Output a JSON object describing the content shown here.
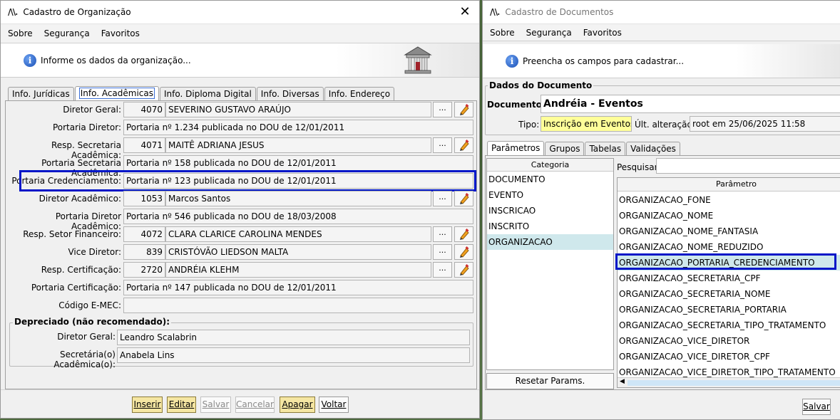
{
  "w1": {
    "title": "Cadastro de Organização",
    "menu": [
      "Sobre",
      "Segurança",
      "Favoritos"
    ],
    "banner_text": "Informe os dados da organização...",
    "tabs": [
      "Info. Jurídicas",
      "Info. Acadêmicas",
      "Info. Diploma Digital",
      "Info. Diversas",
      "Info. Endereço"
    ],
    "active_tab": "Info. Acadêmicas",
    "fields": [
      {
        "label": "Diretor Geral:",
        "code": "4070",
        "value": "SEVERINO GUSTAVO ARAÚJO",
        "lookup": true,
        "edit_enabled": true
      },
      {
        "label": "Portaria Diretor:",
        "value": "Portaria nº 1.234 publicada no DOU de 12/01/2011"
      },
      {
        "label": "Resp. Secretaria Acadêmica:",
        "code": "4071",
        "value": "MAITÊ ADRIANA JESUS",
        "lookup": true,
        "edit_enabled": true
      },
      {
        "label": "Portaria Secretaria Acadêmica:",
        "value": "Portaria nº 158 publicada no DOU de 12/01/2011"
      },
      {
        "label": "Portaria Credenciamento:",
        "value": "Portaria nº 123 publicada no DOU de 12/01/2011",
        "highlighted": true
      },
      {
        "label": "Diretor Acadêmico:",
        "code": "1053",
        "value": "Marcos Santos",
        "lookup": true,
        "edit_enabled": true
      },
      {
        "label": "Portaria Diretor Acadêmico:",
        "value": "Portaria nº 546 publicada no DOU de 18/03/2008"
      },
      {
        "label": "Resp. Setor Financeiro:",
        "code": "4072",
        "value": "CLARA CLARICE CAROLINA MENDES",
        "lookup": true,
        "edit_enabled": true
      },
      {
        "label": "Vice Diretor:",
        "code": "839",
        "value": "CRISTÓVÃO LIEDSON MALTA",
        "lookup": true,
        "edit_enabled": true
      },
      {
        "label": "Resp. Certificação:",
        "code": "2720",
        "value": "ANDRÉIA KLEHM",
        "lookup": true,
        "edit_enabled": true
      },
      {
        "label": "Portaria Certificação:",
        "value": "Portaria nº 147 publicada no DOU de 12/01/2011"
      },
      {
        "label": "Código E-MEC:",
        "value": ""
      }
    ],
    "lookup_label": "...",
    "deprecated": {
      "title": "Depreciado (não recomendado):",
      "fields": [
        {
          "label": "Diretor Geral:",
          "value": "Leandro Scalabrin"
        },
        {
          "label": "Secretária(o) Acadêmica(o):",
          "value": "Anabela Lins"
        }
      ]
    },
    "buttons": [
      {
        "label": "Inserir",
        "state": "primary"
      },
      {
        "label": "Editar",
        "state": "primary"
      },
      {
        "label": "Salvar",
        "state": "disabled"
      },
      {
        "label": "Cancelar",
        "state": "disabled"
      },
      {
        "label": "Apagar",
        "state": "primary"
      },
      {
        "label": "Voltar",
        "state": "normal"
      }
    ]
  },
  "w2": {
    "title": "Cadastro de Documentos",
    "menu": [
      "Sobre",
      "Segurança",
      "Favoritos"
    ],
    "banner_text": "Preencha os campos para cadastrar...",
    "section_title": "Dados do Documento",
    "documento_label": "Documento:",
    "documento_value": "Andréia - Eventos",
    "tipo_label": "Tipo:",
    "tipo_value": "Inscrição em Eventos",
    "ult_label": "Últ. alteração:",
    "ult_value": "root em 25/06/2025 11:58",
    "tabs": [
      "Parâmetros",
      "Grupos",
      "Tabelas",
      "Validações"
    ],
    "active_tab": "Parâmetros",
    "categoria_header": "Categoria",
    "categorias": [
      "DOCUMENTO",
      "EVENTO",
      "INSCRICAO",
      "INSCRITO",
      "ORGANIZACAO"
    ],
    "selected_categoria": "ORGANIZACAO",
    "pesquisar_label": "Pesquisar:",
    "parametro_header": "Parâmetro",
    "parametros": [
      "ORGANIZACAO_FONE",
      "ORGANIZACAO_NOME",
      "ORGANIZACAO_NOME_FANTASIA",
      "ORGANIZACAO_NOME_REDUZIDO",
      "ORGANIZACAO_PORTARIA_CREDENCIAMENTO",
      "ORGANIZACAO_SECRETARIA_CPF",
      "ORGANIZACAO_SECRETARIA_NOME",
      "ORGANIZACAO_SECRETARIA_PORTARIA",
      "ORGANIZACAO_SECRETARIA_TIPO_TRATAMENTO",
      "ORGANIZACAO_VICE_DIRETOR",
      "ORGANIZACAO_VICE_DIRETOR_CPF",
      "ORGANIZACAO_VICE_DIRETOR_TIPO_TRATAMENTO"
    ],
    "selected_parametro": "ORGANIZACAO_PORTARIA_CREDENCIAMENTO",
    "reset_label": "Resetar Params.",
    "salvar_label": "Salvar"
  },
  "colors": {
    "highlight": "#0016c8",
    "selected_row": "#cfe8ec",
    "yellow_button": "#f5e6a2",
    "tipo_field": "#ffff99"
  }
}
